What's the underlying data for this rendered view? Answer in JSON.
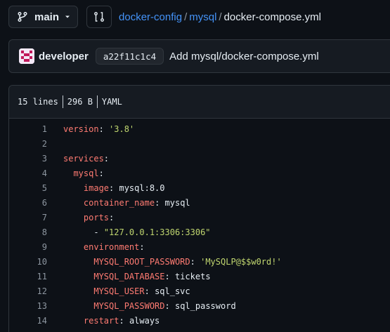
{
  "repo_nav": {
    "branch": "main",
    "breadcrumb": [
      "docker-config",
      "mysql"
    ],
    "separator": "/",
    "file_name": "docker-compose.yml"
  },
  "commit": {
    "author": "developer",
    "sha": "a22f11c1c4",
    "message": "Add mysql/docker-compose.yml"
  },
  "file_info": {
    "lines": "15 lines",
    "size": "296 B",
    "language": "YAML"
  },
  "code_lines": [
    {
      "n": "1",
      "indent": "",
      "key": "version",
      "sep": ": ",
      "value": "'3.8'",
      "vtype": "str"
    },
    {
      "n": "2",
      "indent": "",
      "key": "",
      "sep": "",
      "value": "",
      "vtype": "none"
    },
    {
      "n": "3",
      "indent": "",
      "key": "services",
      "sep": ":",
      "value": "",
      "vtype": "none"
    },
    {
      "n": "4",
      "indent": "  ",
      "key": "mysql",
      "sep": ":",
      "value": "",
      "vtype": "none"
    },
    {
      "n": "5",
      "indent": "    ",
      "key": "image",
      "sep": ": ",
      "value": "mysql:8.0",
      "vtype": "plain"
    },
    {
      "n": "6",
      "indent": "    ",
      "key": "container_name",
      "sep": ": ",
      "value": "mysql",
      "vtype": "plain"
    },
    {
      "n": "7",
      "indent": "    ",
      "key": "ports",
      "sep": ":",
      "value": "",
      "vtype": "none"
    },
    {
      "n": "8",
      "indent": "      ",
      "key": "- ",
      "sep": "",
      "value": "\"127.0.0.1:3306:3306\"",
      "vtype": "str",
      "list": true
    },
    {
      "n": "9",
      "indent": "    ",
      "key": "environment",
      "sep": ":",
      "value": "",
      "vtype": "none"
    },
    {
      "n": "10",
      "indent": "      ",
      "key": "MYSQL_ROOT_PASSWORD",
      "sep": ": ",
      "value": "'MySQLP@$$w0rd!'",
      "vtype": "str"
    },
    {
      "n": "11",
      "indent": "      ",
      "key": "MYSQL_DATABASE",
      "sep": ": ",
      "value": "tickets",
      "vtype": "plain"
    },
    {
      "n": "12",
      "indent": "      ",
      "key": "MYSQL_USER",
      "sep": ": ",
      "value": "sql_svc",
      "vtype": "plain"
    },
    {
      "n": "13",
      "indent": "      ",
      "key": "MYSQL_PASSWORD",
      "sep": ": ",
      "value": "sql_password",
      "vtype": "plain"
    },
    {
      "n": "14",
      "indent": "    ",
      "key": "restart",
      "sep": ": ",
      "value": "always",
      "vtype": "plain"
    }
  ],
  "colors": {
    "background": "#0d1117",
    "panel": "#161b22",
    "border": "#30363d",
    "link": "#4493f8",
    "yaml_key": "#ff7b72",
    "yaml_string": "#a5d6ff"
  }
}
